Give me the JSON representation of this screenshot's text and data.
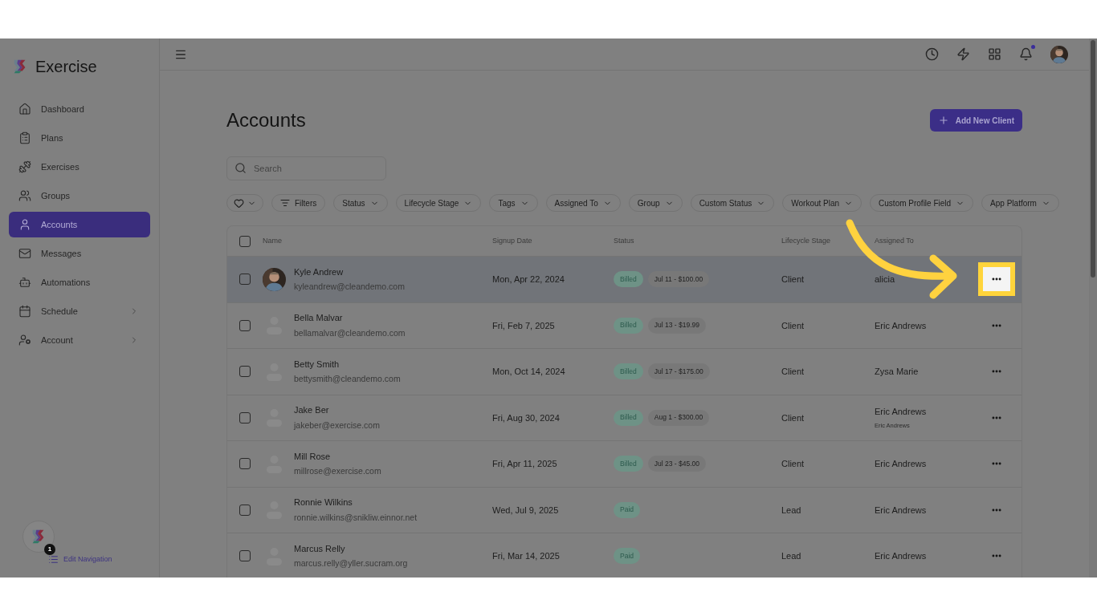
{
  "brand": {
    "name": "Exercise"
  },
  "nav": [
    {
      "label": "Dashboard",
      "selected": false,
      "expandable": false
    },
    {
      "label": "Plans",
      "selected": false,
      "expandable": false
    },
    {
      "label": "Exercises",
      "selected": false,
      "expandable": false
    },
    {
      "label": "Groups",
      "selected": false,
      "expandable": false
    },
    {
      "label": "Accounts",
      "selected": true,
      "expandable": false
    },
    {
      "label": "Messages",
      "selected": false,
      "expandable": false
    },
    {
      "label": "Automations",
      "selected": false,
      "expandable": false
    },
    {
      "label": "Schedule",
      "selected": false,
      "expandable": true
    },
    {
      "label": "Account",
      "selected": false,
      "expandable": true
    }
  ],
  "sidebar_footer": {
    "badge": "1",
    "link": "Edit Navigation"
  },
  "topbar": {
    "has_unread": true
  },
  "page": {
    "title": "Accounts",
    "add_button": "Add New Client",
    "search": {
      "placeholder": "Search"
    }
  },
  "filters": [
    {
      "kind": "favorite"
    },
    {
      "kind": "filters",
      "label": "Filters"
    },
    {
      "kind": "dropdown",
      "label": "Status"
    },
    {
      "kind": "dropdown",
      "label": "Lifecycle Stage"
    },
    {
      "kind": "dropdown",
      "label": "Tags"
    },
    {
      "kind": "dropdown",
      "label": "Assigned To"
    },
    {
      "kind": "dropdown",
      "label": "Group"
    },
    {
      "kind": "dropdown",
      "label": "Custom Status"
    },
    {
      "kind": "dropdown",
      "label": "Workout Plan"
    },
    {
      "kind": "dropdown",
      "label": "Custom Profile Field"
    },
    {
      "kind": "dropdown",
      "label": "App Platform"
    }
  ],
  "table": {
    "columns": [
      "Name",
      "Signup Date",
      "Status",
      "Lifecycle Stage",
      "Assigned To"
    ],
    "all_checked": false,
    "rows": [
      {
        "checked": false,
        "selected": true,
        "callout": true,
        "name": "Kyle Andrew",
        "email": "kyleandrew@cleandemo.com",
        "signup": "Mon, Apr 22, 2024",
        "status": "Billed",
        "invoice": "Jul 11 - $100.00",
        "stage": "Client",
        "assigned": "alicia"
      },
      {
        "checked": false,
        "selected": false,
        "callout": false,
        "kind": "placeholder",
        "name": "Bella Malvar",
        "email": "bellamalvar@cleandemo.com",
        "signup": "Fri, Feb 7, 2025",
        "status": "Billed",
        "invoice": "Jul 13 - $19.99",
        "stage": "Client",
        "assigned": "Eric Andrews"
      },
      {
        "checked": false,
        "selected": false,
        "callout": false,
        "kind": "placeholder",
        "name": "Betty Smith",
        "email": "bettysmith@cleandemo.com",
        "signup": "Mon, Oct 14, 2024",
        "status": "Billed",
        "invoice": "Jul 17 - $175.00",
        "stage": "Client",
        "assigned": "Zysa Marie"
      },
      {
        "checked": false,
        "selected": false,
        "callout": false,
        "kind": "placeholder",
        "name": "Jake Ber",
        "email": "jakeber@exercise.com",
        "signup": "Fri, Aug 30, 2024",
        "status": "Billed",
        "invoice": "Aug 1 - $300.00",
        "stage": "Client",
        "assigned": "Eric Andrews",
        "assigned_secondary": "Eric Andrews"
      },
      {
        "checked": false,
        "selected": false,
        "callout": false,
        "kind": "placeholder",
        "name": "Mill Rose",
        "email": "millrose@exercise.com",
        "signup": "Fri, Apr 11, 2025",
        "status": "Billed",
        "invoice": "Jul 23 - $45.00",
        "stage": "Client",
        "assigned": "Eric Andrews"
      },
      {
        "checked": false,
        "selected": false,
        "callout": false,
        "kind": "placeholder",
        "name": "Ronnie Wilkins",
        "email": "ronnie.wilkins@snikliw.einnor.net",
        "signup": "Wed, Jul 9, 2025",
        "status": "Paid",
        "stage": "Lead",
        "assigned": "Eric Andrews"
      },
      {
        "checked": false,
        "selected": false,
        "callout": false,
        "kind": "placeholder",
        "name": "Marcus Relly",
        "email": "marcus.relly@yller.sucram.org",
        "signup": "Fri, Mar 14, 2025",
        "status": "Paid",
        "stage": "Lead",
        "assigned": "Eric Andrews"
      }
    ]
  }
}
